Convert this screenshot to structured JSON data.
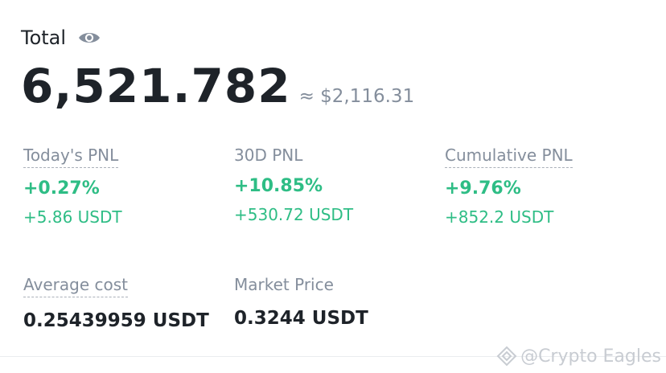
{
  "header": {
    "total_label": "Total",
    "visibility_icon": "eye-icon"
  },
  "balance": {
    "amount": "6,521.782",
    "approx": "≈ $2,116.31"
  },
  "pnl": {
    "today": {
      "label": "Today's PNL",
      "percent": "+0.27%",
      "usdt": "+5.86 USDT"
    },
    "thirty_day": {
      "label": "30D PNL",
      "percent": "+10.85%",
      "usdt": "+530.72 USDT"
    },
    "cumulative": {
      "label": "Cumulative PNL",
      "percent": "+9.76%",
      "usdt": "+852.2 USDT"
    }
  },
  "average_cost": {
    "label": "Average cost",
    "value": "0.25439959 USDT"
  },
  "market_price": {
    "label": "Market Price",
    "value": "0.3244 USDT"
  },
  "watermark": {
    "text": "@Crypto Eagles",
    "logo_icon": "binance-square-logo-icon"
  },
  "colors": {
    "positive": "#2ebd85",
    "primary_text": "#1e2329",
    "secondary_text": "#848e9c"
  }
}
